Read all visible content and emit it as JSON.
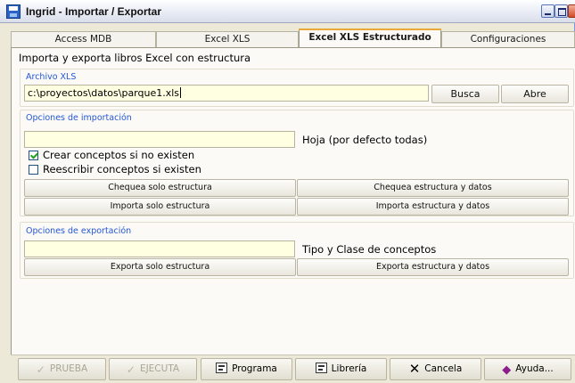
{
  "window": {
    "title": "Ingrid - Importar / Exportar",
    "icon": "floppy-disk-icon"
  },
  "tabs": [
    {
      "label": "Access MDB",
      "active": false
    },
    {
      "label": "Excel XLS",
      "active": false
    },
    {
      "label": "Excel XLS Estructurado",
      "active": true
    },
    {
      "label": "Configuraciones",
      "active": false
    }
  ],
  "description": "Importa y exporta libros Excel con estructura",
  "archivo": {
    "title": "Archivo XLS",
    "path": "c:\\proyectos\\datos\\parque1.xls",
    "busca_label": "Busca",
    "abre_label": "Abre"
  },
  "importacion": {
    "title": "Opciones de importación",
    "hoja_value": "",
    "hoja_label": "Hoja (por defecto todas)",
    "crear_label": "Crear conceptos si no existen",
    "crear_checked": true,
    "reescribir_label": "Reescribir conceptos si existen",
    "reescribir_checked": false,
    "buttons": {
      "chequea_estructura": "Chequea solo estructura",
      "chequea_datos": "Chequea estructura y datos",
      "importa_estructura": "Importa solo estructura",
      "importa_datos": "Importa estructura y datos"
    }
  },
  "exportacion": {
    "title": "Opciones de exportación",
    "tipo_value": "",
    "tipo_label": "Tipo y Clase de conceptos",
    "buttons": {
      "exporta_estructura": "Exporta solo estructura",
      "exporta_datos": "Exporta estructura y datos"
    }
  },
  "toolbar": {
    "prueba": "PRUEBA",
    "ejecuta": "EJECUTA",
    "programa": "Programa",
    "libreria": "Librería",
    "cancela": "Cancela",
    "ayuda": "Ayuda..."
  },
  "colors": {
    "group_title": "#2456d6",
    "input_bg": "#ffffe1",
    "active_tab_accent": "#e8a93a"
  }
}
